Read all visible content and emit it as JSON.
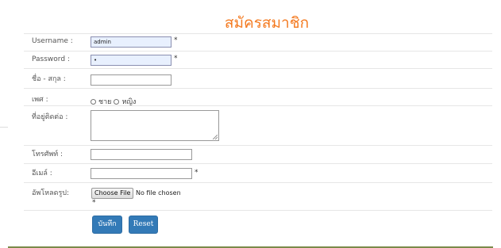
{
  "form": {
    "title": "สมัครสมาชิก",
    "fields": {
      "username": {
        "label": "Username :",
        "value": "admin",
        "required": "*"
      },
      "password": {
        "label": "Password :",
        "value": "•",
        "required": "*"
      },
      "fullname": {
        "label": "ชื่อ - สกุล :",
        "value": ""
      },
      "gender": {
        "label": "เพศ :",
        "option_male": "ชาย",
        "option_female": "หญิง"
      },
      "address": {
        "label": "ที่อยู่ติดต่อ :",
        "value": ""
      },
      "phone": {
        "label": "โทรศัพท์ :",
        "value": ""
      },
      "email": {
        "label": "อีเมล์ :",
        "value": "",
        "required": "*"
      },
      "photo": {
        "label": "อัพโหลดรูป:",
        "button": "Choose File",
        "status": "No file chosen",
        "required": "*"
      }
    },
    "buttons": {
      "save": "บันทึก",
      "reset": "Reset"
    }
  }
}
